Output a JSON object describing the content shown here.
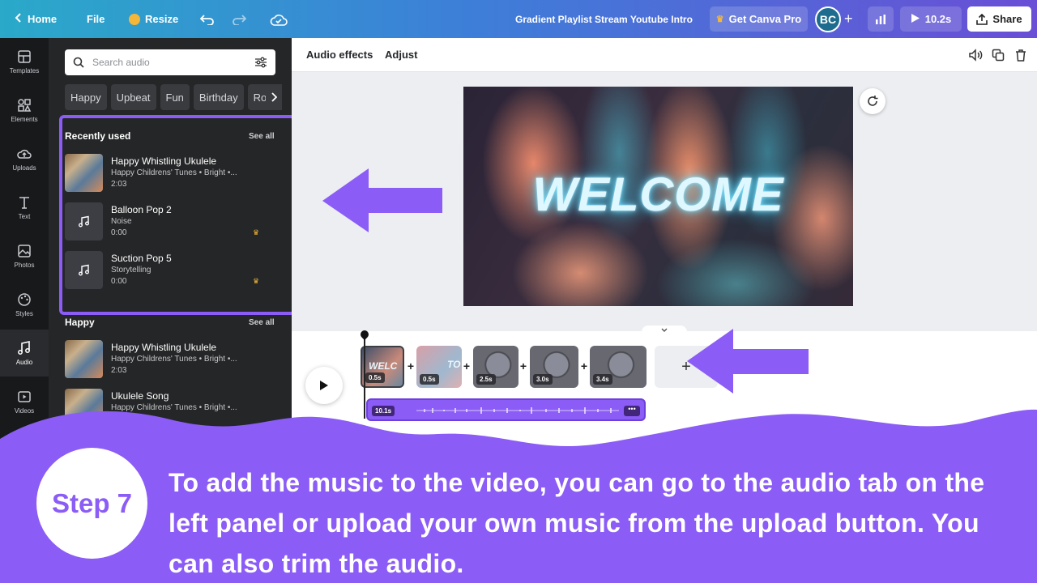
{
  "topbar": {
    "home": "Home",
    "file": "File",
    "resize": "Resize",
    "doc_title": "Gradient Playlist Stream Youtube Intro",
    "get_pro": "Get Canva Pro",
    "avatar": "BC",
    "duration": "10.2s",
    "share": "Share"
  },
  "rail": [
    {
      "label": "Templates",
      "icon": "templates-icon"
    },
    {
      "label": "Elements",
      "icon": "elements-icon"
    },
    {
      "label": "Uploads",
      "icon": "uploads-icon"
    },
    {
      "label": "Text",
      "icon": "text-icon"
    },
    {
      "label": "Photos",
      "icon": "photos-icon"
    },
    {
      "label": "Styles",
      "icon": "styles-icon"
    },
    {
      "label": "Audio",
      "icon": "audio-icon"
    },
    {
      "label": "Videos",
      "icon": "videos-icon"
    }
  ],
  "panel": {
    "search_placeholder": "Search audio",
    "chips": [
      "Happy",
      "Upbeat",
      "Fun",
      "Birthday",
      "Rock"
    ],
    "recent_title": "Recently used",
    "happy_title": "Happy",
    "see_all": "See all",
    "recent": [
      {
        "name": "Happy Whistling Ukulele",
        "meta": "Happy Childrens' Tunes • Bright •...",
        "dur": "2:03",
        "pro": false
      },
      {
        "name": "Balloon Pop 2",
        "meta": "Noise",
        "dur": "0:00",
        "pro": true
      },
      {
        "name": "Suction Pop 5",
        "meta": "Storytelling",
        "dur": "0:00",
        "pro": true
      }
    ],
    "happy": [
      {
        "name": "Happy Whistling Ukulele",
        "meta": "Happy Childrens' Tunes • Bright •...",
        "dur": "2:03"
      },
      {
        "name": "Ukulele Song",
        "meta": "Happy Childrens' Tunes • Bright •..."
      }
    ]
  },
  "context_bar": {
    "audio_effects": "Audio effects",
    "adjust": "Adjust"
  },
  "canvas": {
    "headline": "WELCOME"
  },
  "timeline": {
    "clips": [
      {
        "text": "WELC",
        "dur": "0.5s"
      },
      {
        "text": "TO",
        "dur": "0.5s"
      },
      {
        "text": "",
        "dur": "2.5s"
      },
      {
        "text": "",
        "dur": "3.0s"
      },
      {
        "text": "",
        "dur": "3.4s"
      }
    ],
    "add": "+",
    "audio_dur": "10.1s",
    "audio_more": "•••"
  },
  "overlay": {
    "step": "Step 7",
    "text": "To add the music to the video, you can go to the audio tab on the left panel or upload your own music from the upload button. You can also trim the audio.",
    "accent": "#8b5cf6"
  }
}
